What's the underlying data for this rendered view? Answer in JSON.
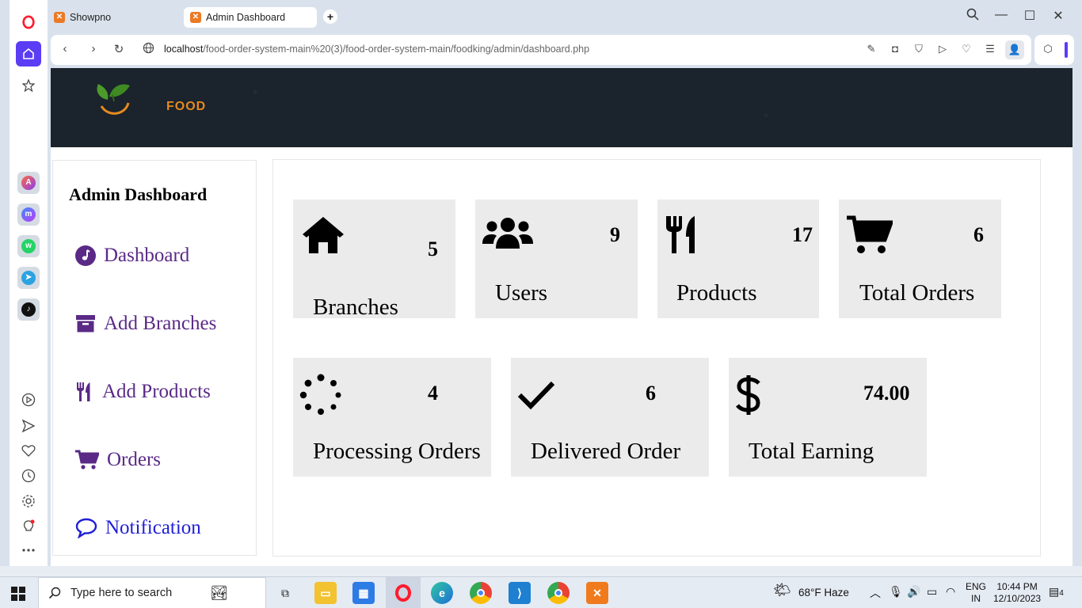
{
  "browser": {
    "tabs": [
      {
        "title": "Showpno",
        "active": false
      },
      {
        "title": "Admin Dashboard",
        "active": true
      }
    ],
    "url_host": "localhost",
    "url_path": "/food-order-system-main%20(3)/food-order-system-main/foodking/admin/dashboard.php"
  },
  "header": {
    "logo_text": "FOOD"
  },
  "sidebar": {
    "title": "Admin Dashboard",
    "items": [
      {
        "label": "Dashboard",
        "icon": "music-note-icon"
      },
      {
        "label": "Add Branches",
        "icon": "archive-box-icon"
      },
      {
        "label": "Add Products",
        "icon": "utensils-icon"
      },
      {
        "label": "Orders",
        "icon": "cart-icon"
      },
      {
        "label": "Notification",
        "icon": "chat-bubble-icon"
      }
    ]
  },
  "stats": [
    {
      "label": "Branches",
      "value": "5",
      "icon": "home-icon"
    },
    {
      "label": "Users",
      "value": "9",
      "icon": "users-icon"
    },
    {
      "label": "Products",
      "value": "17",
      "icon": "utensils-icon"
    },
    {
      "label": "Total Orders",
      "value": "6",
      "icon": "cart-icon"
    },
    {
      "label": "Processing Orders",
      "value": "4",
      "icon": "spinner-icon"
    },
    {
      "label": "Delivered Order",
      "value": "6",
      "icon": "check-icon"
    },
    {
      "label": "Total Earning",
      "value": "74.00",
      "icon": "dollar-icon"
    }
  ],
  "taskbar": {
    "search_placeholder": "Type here to search",
    "weather": "68°F  Haze",
    "lang_top": "ENG",
    "lang_bottom": "IN",
    "time": "10:44 PM",
    "date": "12/10/2023",
    "notification_count": "4"
  },
  "colors": {
    "sidebar_link": "#5a2a86",
    "notification_link": "#1f1fd6",
    "card_bg": "#ebebeb",
    "header_bg": "#1b232c",
    "logo_orange": "#e58a1f"
  }
}
